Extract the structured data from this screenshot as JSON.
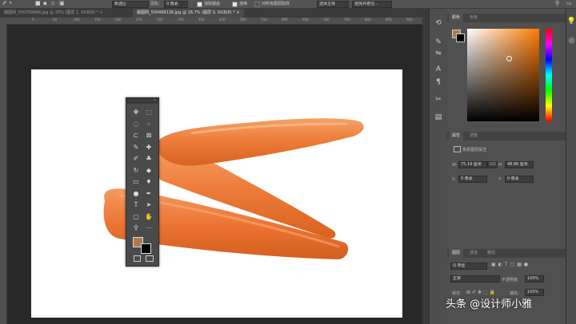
{
  "options_bar": {
    "mode_value": "新选区",
    "feather_label": "羽化:",
    "feather_value": "0 像素",
    "antialias_label": "消除锯齿",
    "contiguous_label": "连续",
    "sample_all_label": "对所有图层取样",
    "select_subject_label": "选择主体",
    "select_mask_label": "选择并遮住..."
  },
  "tabs": [
    {
      "label": "摄图网_500799986.jpg @ 25% (图层 1, RGB/8) *",
      "close": "×"
    },
    {
      "label": "摄图网_500499136.jpg @ 16.7% (图层 0, RGB/8) *",
      "close": "×"
    }
  ],
  "ruler": {
    "ticks": [
      "0",
      "50",
      "100",
      "150",
      "200",
      "250",
      "300",
      "350",
      "400",
      "450",
      "500",
      "550",
      "600",
      "650",
      "700",
      "750",
      "800",
      "850",
      "900"
    ]
  },
  "color_panel": {
    "tabs": [
      "颜色",
      "色板"
    ],
    "foreground": "#b07a4e",
    "background": "#000000"
  },
  "properties_panel": {
    "tabs": [
      "属性",
      "调整"
    ],
    "layer_type": "像素图层属性",
    "w_label": "W:",
    "w_value": "75.19 厘米",
    "link_label": "GO",
    "h_label": "H:",
    "h_value": "48.86 厘米",
    "x_label": "X:",
    "x_value": "0 像素",
    "y_label": "Y:",
    "y_value": "0 像素"
  },
  "layers_panel": {
    "tabs": [
      "图层",
      "通道",
      "路径"
    ],
    "filter_label": "Q 类型",
    "blend_mode": "正常",
    "opacity_label": "不透明度:",
    "opacity_value": "100%",
    "lock_label": "锁定:",
    "fill_label": "填充:",
    "fill_value": "100%"
  },
  "tools": [
    "move-tool",
    "artboard-tool",
    "lasso-tool",
    "magic-wand-tool",
    "crop-tool",
    "frame-tool",
    "eyedropper-tool",
    "healing-brush-tool",
    "brush-tool",
    "clone-stamp-tool",
    "history-brush-tool",
    "eraser-tool",
    "gradient-tool",
    "blur-tool",
    "dodge-tool",
    "pen-tool",
    "type-tool",
    "path-selection-tool",
    "rectangle-tool",
    "hand-tool",
    "zoom-tool",
    "edit-toolbar"
  ],
  "tool_glyphs": [
    "✥",
    "⬚",
    "◌",
    "⁘",
    "⊏",
    "⊠",
    "✎",
    "✚",
    "✐",
    "♣",
    "↻",
    "◆",
    "▭",
    "♦",
    "●",
    "✒",
    "T",
    "➤",
    "▢",
    "✋",
    "⚲",
    "⋯"
  ],
  "tools_collapse_label": "‹‹",
  "watermark": "头条 @设计师小雅"
}
